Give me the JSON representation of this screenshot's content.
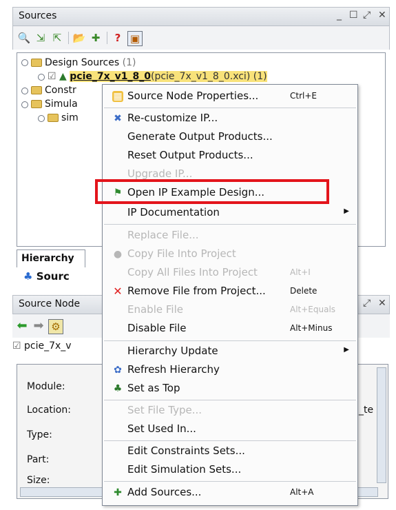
{
  "panel": {
    "title": "Sources"
  },
  "tree": {
    "design_sources": "Design Sources",
    "design_sources_count": "(1)",
    "ip_name": "pcie_7x_v1_8_0",
    "ip_detail": "(pcie_7x_v1_8_0.xci) (1)",
    "constraints_partial": "Constr",
    "simulation_partial": "Simula",
    "sim_partial": "sim"
  },
  "tabs": {
    "hierarchy": "Hierarchy",
    "sources": "Sourc"
  },
  "panel2": {
    "title": "Source Node",
    "file": "pcie_7x_v"
  },
  "details": {
    "module": "Module:",
    "location": "Location:",
    "location_value_partial": "_te",
    "type": "Type:",
    "part": "Part:",
    "size": "Size:"
  },
  "menu": {
    "items": [
      {
        "label": "Source Node Properties...",
        "shortcut": "Ctrl+E"
      },
      {
        "label": "Re-customize IP..."
      },
      {
        "label": "Generate Output Products..."
      },
      {
        "label": "Reset Output Products..."
      },
      {
        "label": "Upgrade IP..."
      },
      {
        "label": "Open IP Example Design..."
      },
      {
        "label": "IP Documentation"
      },
      {
        "label": "Replace File..."
      },
      {
        "label": "Copy File Into Project"
      },
      {
        "label": "Copy All Files Into Project",
        "shortcut": "Alt+I"
      },
      {
        "label": "Remove File from Project...",
        "shortcut": "Delete"
      },
      {
        "label": "Enable File",
        "shortcut": "Alt+Equals"
      },
      {
        "label": "Disable File",
        "shortcut": "Alt+Minus"
      },
      {
        "label": "Hierarchy Update"
      },
      {
        "label": "Refresh Hierarchy"
      },
      {
        "label": "Set as Top"
      },
      {
        "label": "Set File Type..."
      },
      {
        "label": "Set Used In..."
      },
      {
        "label": "Edit Constraints Sets..."
      },
      {
        "label": "Edit Simulation Sets..."
      },
      {
        "label": "Add Sources...",
        "shortcut": "Alt+A"
      }
    ]
  },
  "colors": {
    "highlight_box": "#e3141b",
    "selection": "#f8e27a"
  }
}
